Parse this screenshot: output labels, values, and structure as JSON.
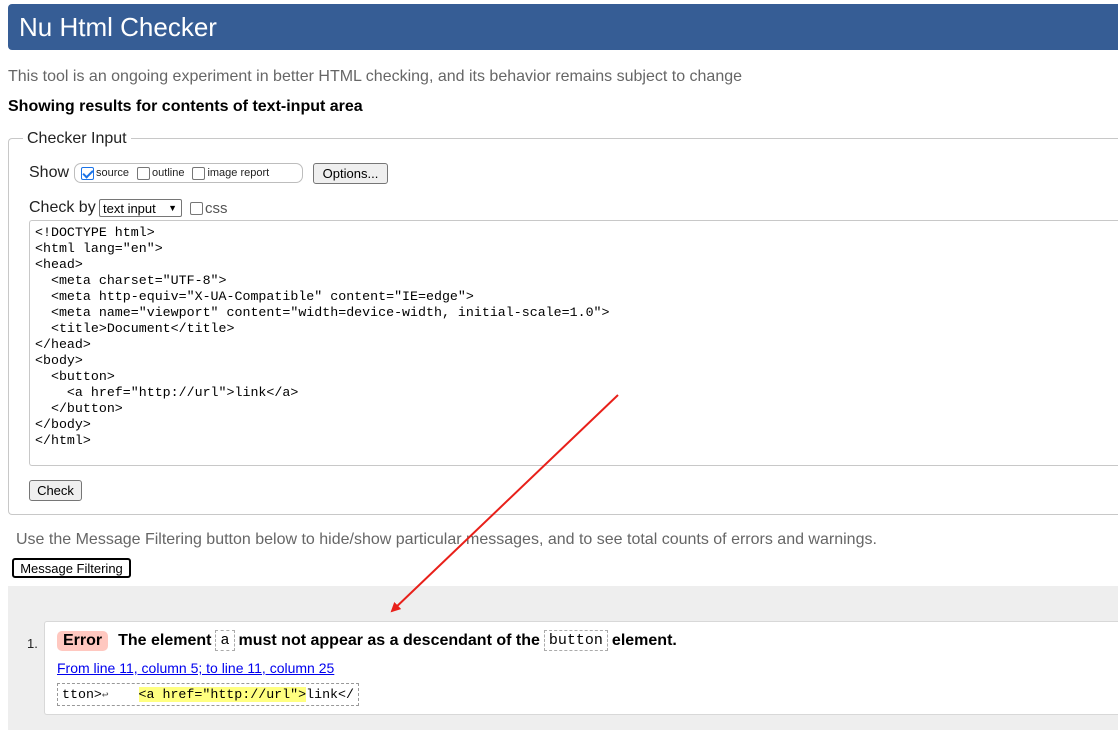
{
  "header": {
    "title": "Nu Html Checker"
  },
  "tagline": "This tool is an ongoing experiment in better HTML checking, and its behavior remains subject to change",
  "showing": "Showing results for contents of text-input area",
  "checker_input": {
    "legend": "Checker Input",
    "show_label": "Show",
    "show_options": [
      {
        "label": "source",
        "checked": true
      },
      {
        "label": "outline",
        "checked": false
      },
      {
        "label": "image report",
        "checked": false
      }
    ],
    "options_button": "Options...",
    "check_by_label": "Check by",
    "check_by_value": "text input",
    "css_label": "css",
    "source_text": "<!DOCTYPE html>\n<html lang=\"en\">\n<head>\n  <meta charset=\"UTF-8\">\n  <meta http-equiv=\"X-UA-Compatible\" content=\"IE=edge\">\n  <meta name=\"viewport\" content=\"width=device-width, initial-scale=1.0\">\n  <title>Document</title>\n</head>\n<body>\n  <button>\n    <a href=\"http://url\">link</a>\n  </button>\n</body>\n</html>",
    "check_button": "Check"
  },
  "filter": {
    "text": "Use the Message Filtering button below to hide/show particular messages, and to see total counts of errors and warnings.",
    "button": "Message Filtering"
  },
  "messages": [
    {
      "number": "1.",
      "type": "Error",
      "text_before": "The element",
      "code1": "a",
      "text_middle": "must not appear as a descendant of the",
      "code2": "button",
      "text_after": "element.",
      "location": "From line 11, column 5; to line 11, column 25",
      "extract_before": "tton>",
      "extract_return": "↩",
      "extract_highlight": "<a href=\"http://url\">",
      "extract_after": "link</"
    }
  ],
  "colors": {
    "header_bg": "#365d95",
    "error_badge": "#ffc8c0",
    "highlight": "#ffff80",
    "annotation_arrow": "#e8201a"
  }
}
